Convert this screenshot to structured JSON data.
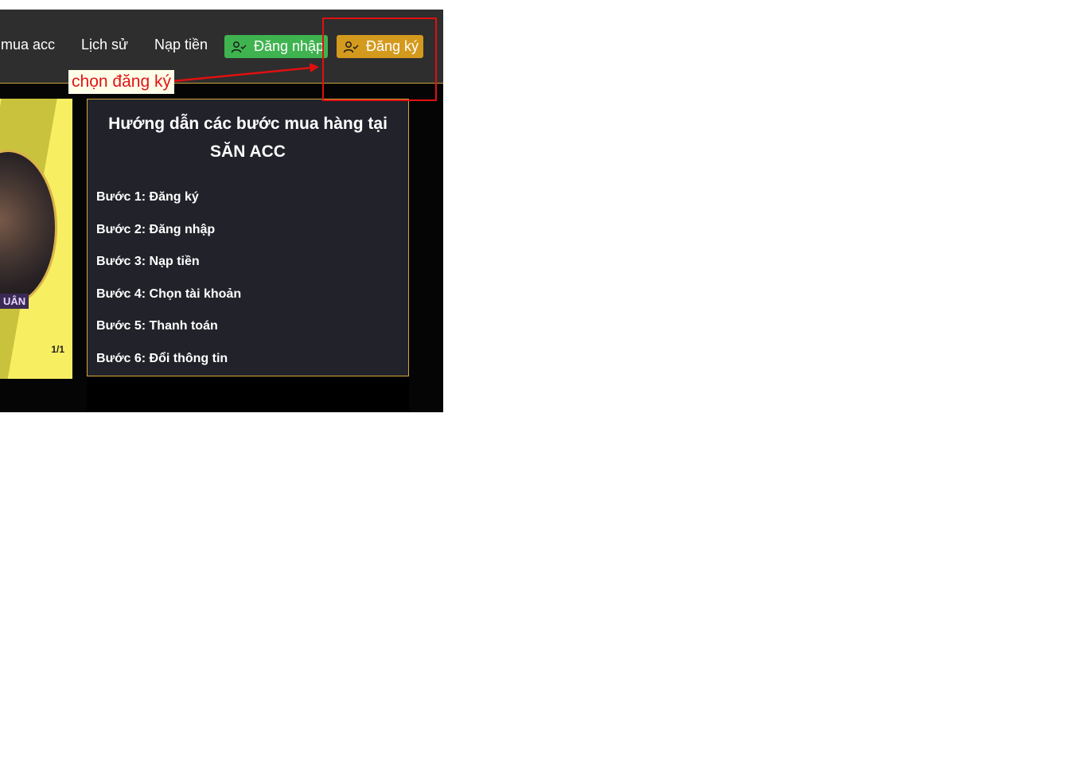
{
  "navbar": {
    "links": [
      "mua acc",
      "Lịch sử",
      "Nạp tiền"
    ],
    "login_button": "Đăng nhập",
    "register_button": "Đăng ký",
    "login_icon": "user-check-icon",
    "register_icon": "user-check-icon"
  },
  "banner": {
    "badge_text": "UÂN",
    "pager": "1/1"
  },
  "guide": {
    "title_line1": "Hướng dẫn các bước mua hàng tại",
    "title_line2": "SĂN ACC",
    "steps": [
      "Bước 1: Đăng ký",
      "Bước 2: Đăng nhập",
      "Bước 3: Nạp tiền",
      "Bước 4: Chọn tài khoản",
      "Bước 5: Thanh toán",
      "Bước 6: Đổi thông tin"
    ]
  },
  "annotation": {
    "label": "chọn đăng ký"
  },
  "colors": {
    "navbar_bg": "#2e2e2e",
    "login_green": "#3fb34f",
    "register_orange": "#d49a1e",
    "guide_border": "#d6a63a",
    "annotation_red": "#e01010"
  }
}
